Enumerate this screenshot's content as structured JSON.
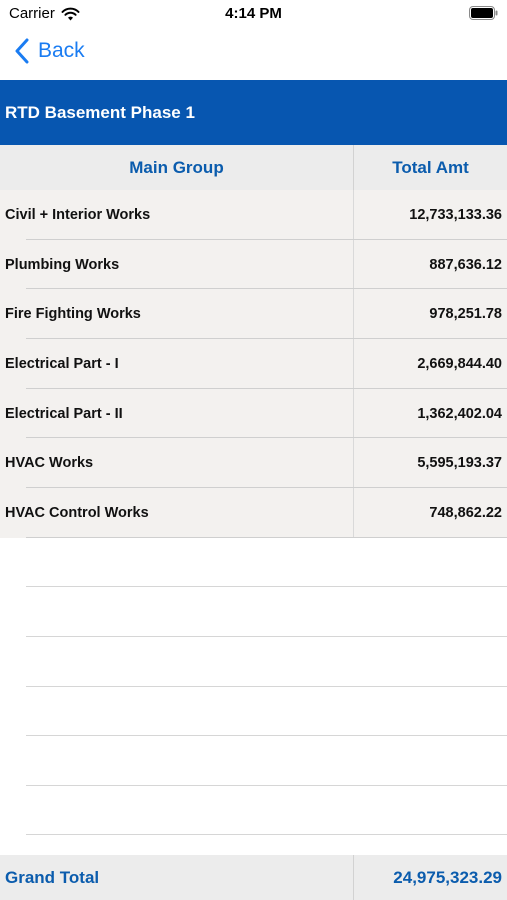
{
  "status_bar": {
    "carrier": "Carrier",
    "time": "4:14 PM"
  },
  "nav": {
    "back_label": "Back"
  },
  "title": "RTD Basement Phase 1",
  "table": {
    "headers": {
      "group": "Main Group",
      "amount": "Total Amt"
    },
    "rows": [
      {
        "group": "Civil + Interior Works",
        "amount": "12,733,133.36"
      },
      {
        "group": "Plumbing Works",
        "amount": "887,636.12"
      },
      {
        "group": "Fire Fighting Works",
        "amount": "978,251.78"
      },
      {
        "group": "Electrical Part - I",
        "amount": "2,669,844.40"
      },
      {
        "group": "Electrical Part - II",
        "amount": "1,362,402.04"
      },
      {
        "group": "HVAC Works",
        "amount": "5,595,193.37"
      },
      {
        "group": "HVAC Control Works",
        "amount": "748,862.22"
      }
    ]
  },
  "footer": {
    "label": "Grand Total",
    "amount": "24,975,323.29"
  },
  "colors": {
    "banner": "#0756b0",
    "accent_text": "#0b5cad",
    "back_link": "#1a7cf2",
    "row_background": "#f3f1ef"
  },
  "icons": [
    "wifi-icon",
    "battery-icon",
    "chevron-left-icon"
  ]
}
